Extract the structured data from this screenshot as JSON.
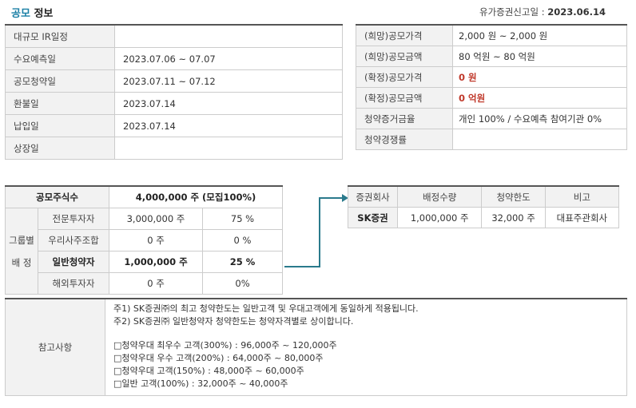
{
  "header": {
    "title_accent": "공모",
    "title_rest": "정보",
    "filed_label": "유가증권신고일 :",
    "filed_date": "2023.06.14"
  },
  "schedule": [
    {
      "label": "대규모 IR일정",
      "value": ""
    },
    {
      "label": "수요예측일",
      "value": "2023.07.06 ~ 07.07"
    },
    {
      "label": "공모청약일",
      "value": "2023.07.11 ~ 07.12"
    },
    {
      "label": "환불일",
      "value": "2023.07.14"
    },
    {
      "label": "납입일",
      "value": "2023.07.14"
    },
    {
      "label": "상장일",
      "value": ""
    }
  ],
  "pricing": [
    {
      "label": "(희망)공모가격",
      "value": "2,000 원 ~ 2,000 원",
      "highlight": false
    },
    {
      "label": "(희망)공모금액",
      "value": "80 억원  ~ 80 억원",
      "highlight": false
    },
    {
      "label": "(확정)공모가격",
      "value": "0 원",
      "highlight": true
    },
    {
      "label": "(확정)공모금액",
      "value": "0 억원",
      "highlight": true
    },
    {
      "label": "청약증거금율",
      "value": "개인 100% / 수요예측 참여기관 0%",
      "highlight": false
    },
    {
      "label": "청약경쟁률",
      "value": "",
      "highlight": false
    }
  ],
  "allocation": {
    "total_label": "공모주식수",
    "total_value": "4,000,000 주 (모집100%)",
    "group_label_1": "그룹별",
    "group_label_2": "배 정",
    "rows": [
      {
        "name": "전문투자자",
        "shares": "3,000,000 주",
        "pct": "75 %"
      },
      {
        "name": "우리사주조합",
        "shares": "0 주",
        "pct": "0 %"
      },
      {
        "name": "일반청약자",
        "shares": "1,000,000 주",
        "pct": "25 %"
      },
      {
        "name": "해외투자자",
        "shares": "0 주",
        "pct": "0%"
      }
    ]
  },
  "underwriters": {
    "headers": [
      "증권회사",
      "배정수량",
      "청약한도",
      "비고"
    ],
    "rows": [
      {
        "company": "SK증권",
        "quantity": "1,000,000 주",
        "limit": "32,000 주",
        "note": "대표주관회사"
      }
    ]
  },
  "notes": {
    "label": "참고사항",
    "lines": [
      "주1) SK증권㈜의 최고 청약한도는 일반고객 및 우대고객에게 동일하게 적용됩니다.",
      "주2) SK증권㈜ 일반청약자 청약한도는 청약자격별로 상이합니다.",
      "",
      "□청약우대 최우수 고객(300%) : 96,000주 ~ 120,000주",
      "□청약우대 우수 고객(200%) : 64,000주 ~ 80,000주",
      "□청약우대 고객(150%) : 48,000주 ~ 60,000주",
      "□일반 고객(100%) : 32,000주 ~ 40,000주"
    ]
  },
  "colors": {
    "accent": "#1a7fa5",
    "highlight": "#c0392b",
    "connector": "#2a7a8c"
  }
}
